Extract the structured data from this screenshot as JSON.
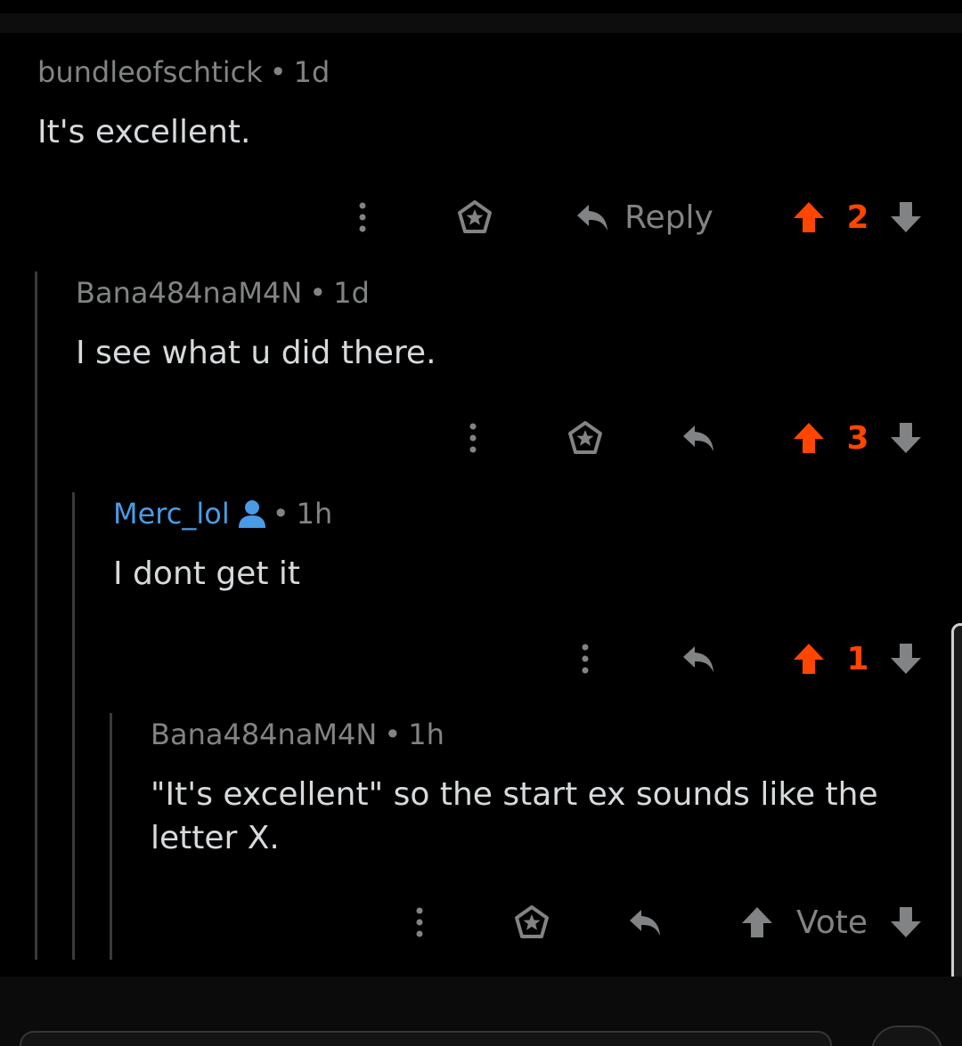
{
  "comments": [
    {
      "author": "bundleofschtick",
      "time": "1d",
      "body": "It's excellent.",
      "reply_label": "Reply",
      "score": "2"
    },
    {
      "author": "Bana484naM4N",
      "time": "1d",
      "body": "I see what u did there.",
      "score": "3"
    },
    {
      "author": "Merc_lol",
      "time": "1h",
      "body": "I dont get it",
      "score": "1"
    },
    {
      "author": "Bana484naM4N",
      "time": "1h",
      "body": "\"It's excellent\" so the start ex sounds like the letter X.",
      "vote_label": "Vote"
    }
  ],
  "meta_separator": "•",
  "colors": {
    "background": "#000000",
    "text": "#d7dadc",
    "muted": "#818384",
    "upvote": "#ff4500",
    "user_link": "#4a9be5",
    "thread_line": "#3a3a3c"
  },
  "icons": {
    "more": "vertical-dots-icon",
    "award": "award-icon",
    "reply": "reply-arrow-icon",
    "upvote": "upvote-arrow-icon",
    "downvote": "downvote-arrow-icon",
    "op": "user-icon"
  }
}
